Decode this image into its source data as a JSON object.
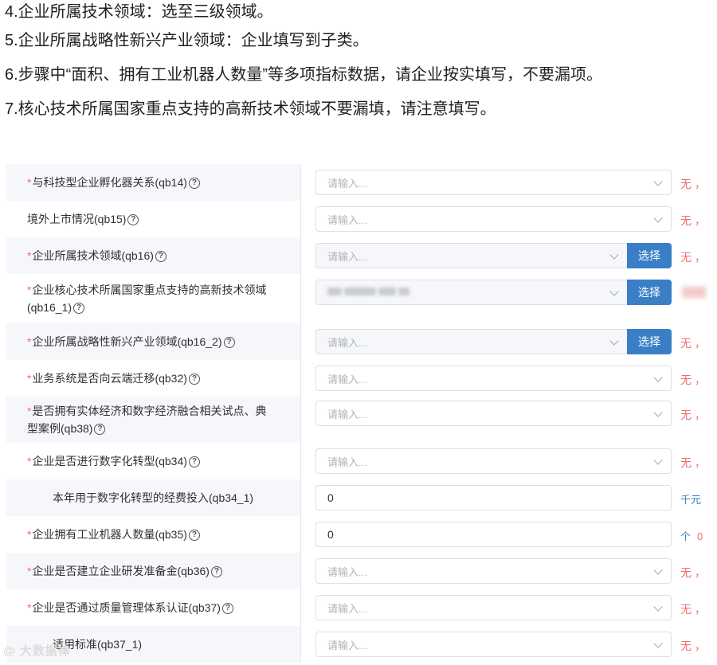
{
  "instructions": [
    "4.企业所属技术领域：选至三级领域。",
    "5.企业所属战略性新兴产业领域：企业填写到子类。",
    "6.步骤中“面积、拥有工业机器人数量”等多项指标数据，请企业按实填写，不要漏项。",
    "7.核心技术所属国家重点支持的高新技术领域不要漏填，请注意填写。"
  ],
  "form": {
    "placeholder": "请输入...",
    "select_button": "选择",
    "rows": [
      {
        "label": "与科技型企业孵化器关系(qb14)",
        "required": true,
        "note": "无 ，"
      },
      {
        "label": "境外上市情况(qb15)",
        "required": false,
        "note": "无 ，"
      },
      {
        "label": "企业所属技术领域(qb16)",
        "required": true,
        "note": "无 ，"
      },
      {
        "label": "企业核心技术所属国家重点支持的高新技术领域",
        "label2": "(qb16_1)",
        "required": true,
        "note": ""
      },
      {
        "label": "企业所属战略性新兴产业领域(qb16_2)",
        "required": true,
        "note": "无 ，"
      },
      {
        "label": "业务系统是否向云端迁移(qb32)",
        "required": true,
        "note": "无 ，"
      },
      {
        "label": "是否拥有实体经济和数字经济融合相关试点、典",
        "label2": "型案例(qb38)",
        "required": true,
        "note": "无 ，"
      },
      {
        "label": "企业是否进行数字化转型(qb34)",
        "required": true,
        "note": "无 ，"
      },
      {
        "label": "本年用于数字化转型的经费投入(qb34_1)",
        "required": false,
        "value": "0",
        "unit": "千元"
      },
      {
        "label": "企业拥有工业机器人数量(qb35)",
        "required": true,
        "value": "0",
        "unit": "个",
        "unit_extra": "0"
      },
      {
        "label": "企业是否建立企业研发准备金(qb36)",
        "required": true,
        "note": "无 ，"
      },
      {
        "label": "企业是否通过质量管理体系认证(qb37)",
        "required": true,
        "note": "无 ，"
      },
      {
        "label": "适用标准(qb37_1)",
        "required": false,
        "note": "无 ，"
      }
    ]
  },
  "watermark": "大数据律"
}
